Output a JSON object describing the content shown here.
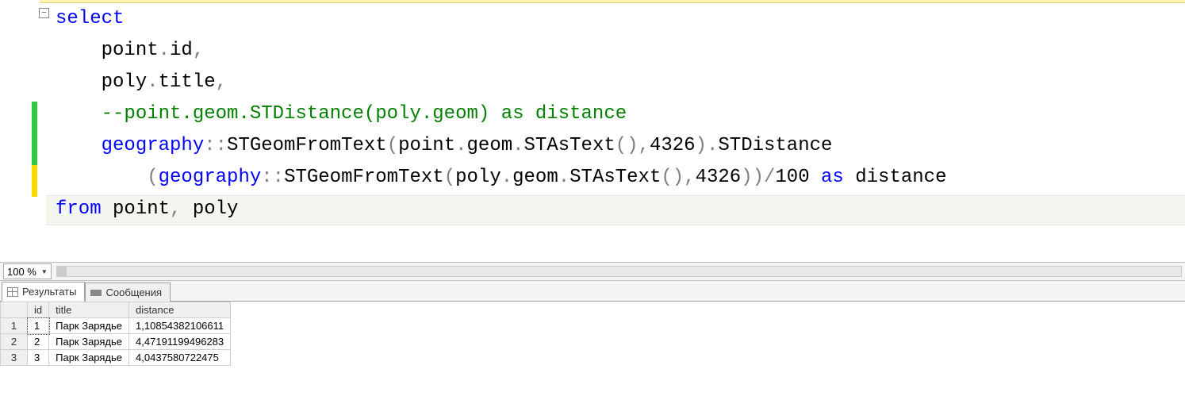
{
  "editor": {
    "fold_glyph": "−",
    "lines": [
      {
        "indent": 0,
        "tokens": [
          {
            "t": "select",
            "c": "kw"
          }
        ]
      },
      {
        "indent": 1,
        "tokens": [
          {
            "t": "point",
            "c": ""
          },
          {
            "t": ".",
            "c": "op"
          },
          {
            "t": "id",
            "c": ""
          },
          {
            "t": ",",
            "c": "op"
          }
        ]
      },
      {
        "indent": 1,
        "tokens": [
          {
            "t": "poly",
            "c": ""
          },
          {
            "t": ".",
            "c": "op"
          },
          {
            "t": "title",
            "c": ""
          },
          {
            "t": ",",
            "c": "op"
          }
        ]
      },
      {
        "indent": 1,
        "tokens": [
          {
            "t": "--point.geom.STDistance(poly.geom) as distance",
            "c": "com"
          }
        ]
      },
      {
        "indent": 1,
        "tokens": [
          {
            "t": "geography",
            "c": "kw"
          },
          {
            "t": "::",
            "c": "op"
          },
          {
            "t": "STGeomFromText",
            "c": ""
          },
          {
            "t": "(",
            "c": "op"
          },
          {
            "t": "point",
            "c": ""
          },
          {
            "t": ".",
            "c": "op"
          },
          {
            "t": "geom",
            "c": ""
          },
          {
            "t": ".",
            "c": "op"
          },
          {
            "t": "STAsText",
            "c": ""
          },
          {
            "t": "(),",
            "c": "op"
          },
          {
            "t": "4326",
            "c": "num"
          },
          {
            "t": ").",
            "c": "op"
          },
          {
            "t": "STDistance",
            "c": ""
          }
        ]
      },
      {
        "indent": 2,
        "tokens": [
          {
            "t": "(",
            "c": "op"
          },
          {
            "t": "geography",
            "c": "kw"
          },
          {
            "t": "::",
            "c": "op"
          },
          {
            "t": "STGeomFromText",
            "c": ""
          },
          {
            "t": "(",
            "c": "op"
          },
          {
            "t": "poly",
            "c": ""
          },
          {
            "t": ".",
            "c": "op"
          },
          {
            "t": "geom",
            "c": ""
          },
          {
            "t": ".",
            "c": "op"
          },
          {
            "t": "STAsText",
            "c": ""
          },
          {
            "t": "(),",
            "c": "op"
          },
          {
            "t": "4326",
            "c": "num"
          },
          {
            "t": "))/",
            "c": "op"
          },
          {
            "t": "100",
            "c": "num"
          },
          {
            "t": " ",
            "c": ""
          },
          {
            "t": "as",
            "c": "kw"
          },
          {
            "t": " distance",
            "c": ""
          }
        ]
      },
      {
        "indent": 0,
        "tokens": [
          {
            "t": "from",
            "c": "kw"
          },
          {
            "t": " point",
            "c": ""
          },
          {
            "t": ",",
            "c": "op"
          },
          {
            "t": " poly",
            "c": ""
          }
        ]
      }
    ]
  },
  "zoom": {
    "value": "100 %"
  },
  "tabs": {
    "results_label": "Результаты",
    "messages_label": "Сообщения"
  },
  "grid": {
    "columns": [
      "id",
      "title",
      "distance"
    ],
    "rows": [
      {
        "n": "1",
        "id": "1",
        "title": "Парк Зарядье",
        "distance": "1,10854382106611"
      },
      {
        "n": "2",
        "id": "2",
        "title": "Парк Зарядье",
        "distance": "4,47191199496283"
      },
      {
        "n": "3",
        "id": "3",
        "title": "Парк Зарядье",
        "distance": "4,0437580722475"
      }
    ]
  }
}
